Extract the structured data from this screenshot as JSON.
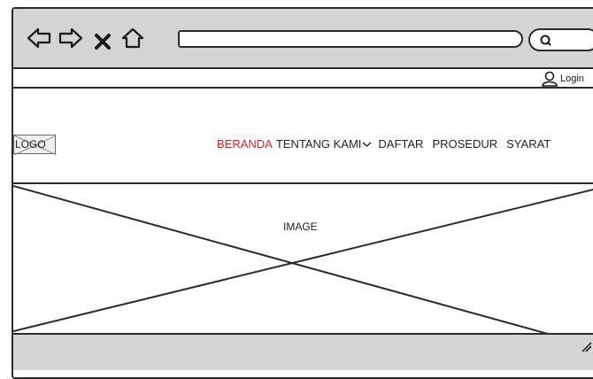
{
  "browser": {
    "back_icon": "back-arrow-icon",
    "forward_icon": "forward-arrow-icon",
    "close_icon": "close-icon",
    "home_icon": "home-icon",
    "search_icon": "search-icon",
    "address_value": ""
  },
  "header": {
    "login_label": "Login",
    "login_icon": "user-icon"
  },
  "logo": {
    "label": "LOGO"
  },
  "nav": {
    "items": [
      {
        "label": "BERANDA",
        "active": true
      },
      {
        "label": "TENTANG KAMI",
        "has_dropdown": true
      },
      {
        "label": "DAFTAR"
      },
      {
        "label": "PROSEDUR"
      },
      {
        "label": "SYARAT"
      }
    ],
    "active_color": "#d6262b"
  },
  "hero": {
    "label": "IMAGE"
  },
  "colors": {
    "chrome": "#d4d4d4",
    "stroke": "#2b2b2b"
  }
}
